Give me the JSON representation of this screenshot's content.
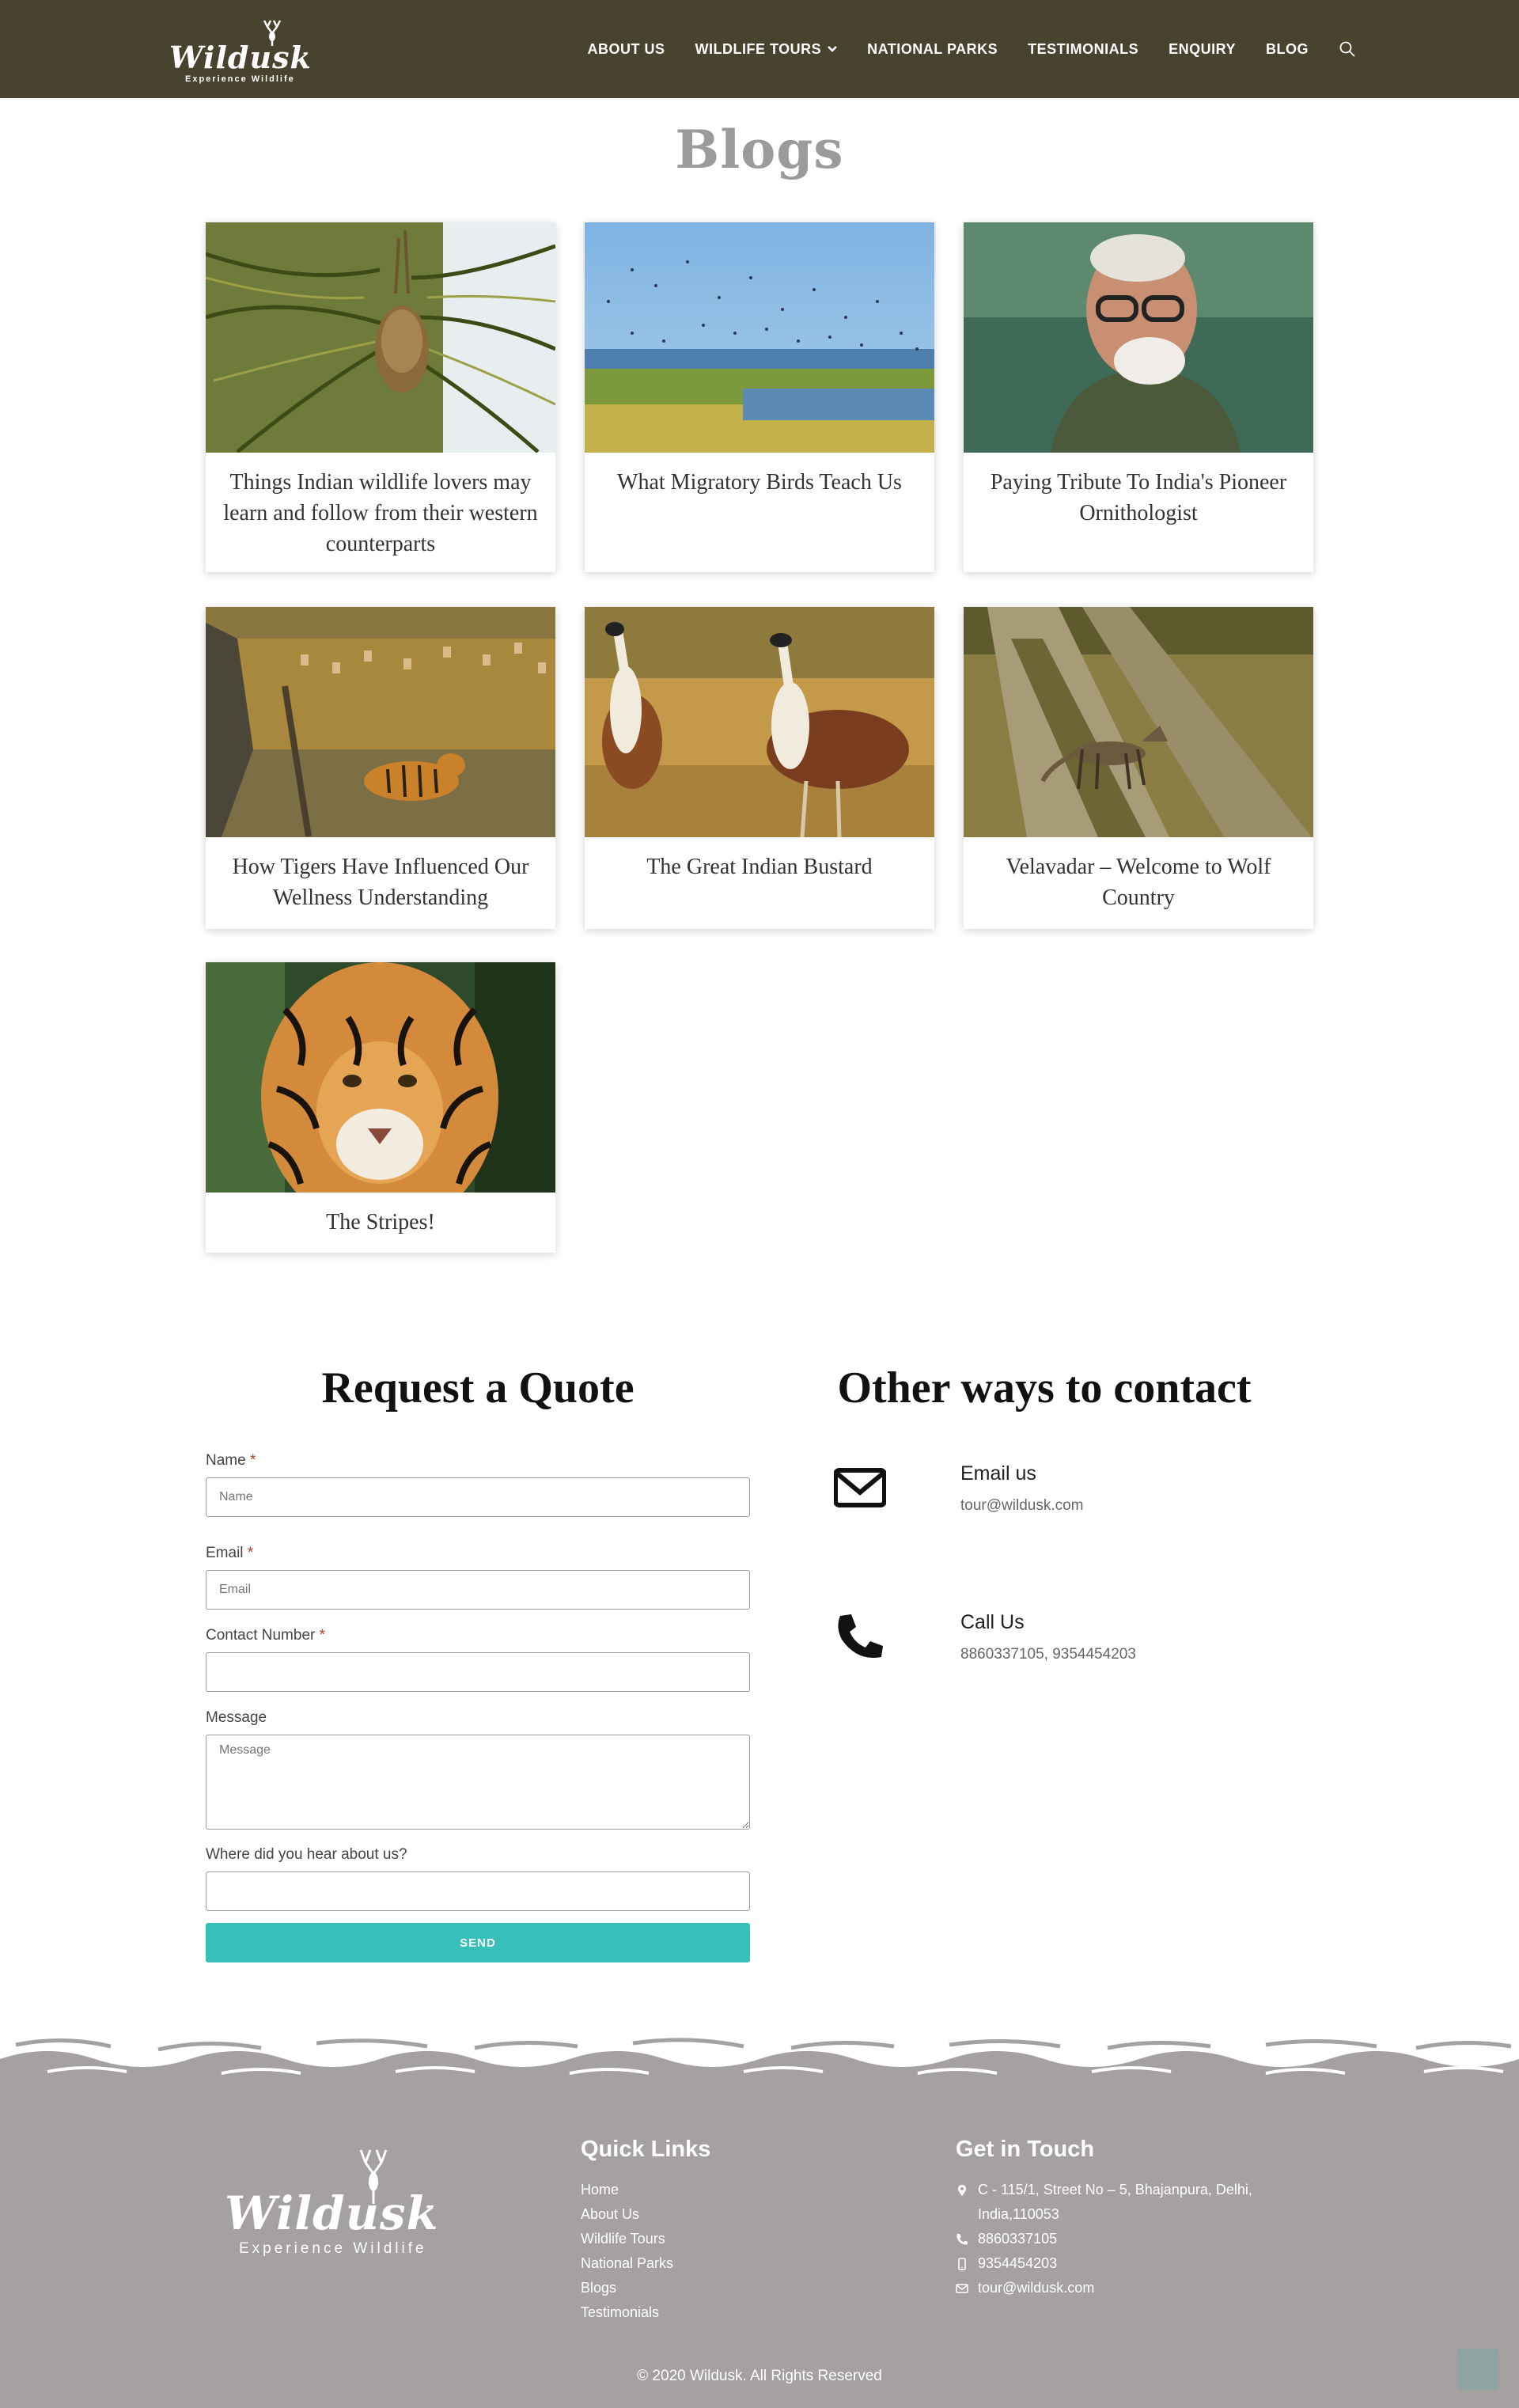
{
  "header": {
    "logo_text": "Wildusk",
    "logo_tagline": "Experience Wildlife",
    "nav": [
      {
        "label": "ABOUT US"
      },
      {
        "label": "WILDLIFE TOURS",
        "has_dropdown": true
      },
      {
        "label": "NATIONAL PARKS"
      },
      {
        "label": "TESTIMONIALS"
      },
      {
        "label": "ENQUIRY"
      },
      {
        "label": "BLOG"
      }
    ],
    "search_icon": "search-icon",
    "bg_color": "#48432f"
  },
  "blogs": {
    "title": "Blogs",
    "cards": [
      {
        "title": "Things Indian wildlife lovers may learn and follow from their western counterparts",
        "image": "weaver-nest-photo"
      },
      {
        "title": "What Migratory Birds Teach Us",
        "image": "migratory-birds-wetland-photo"
      },
      {
        "title": "Paying Tribute To India's Pioneer Ornithologist",
        "image": "ornithologist-portrait-photo"
      },
      {
        "title": "How Tigers Have Influenced Our Wellness Understanding",
        "image": "tiger-grassland-photo"
      },
      {
        "title": "The Great Indian Bustard",
        "image": "bustard-pair-photo"
      },
      {
        "title": "Velavadar – Welcome to Wolf Country",
        "image": "wolf-on-trail-photo"
      },
      {
        "title": "The Stripes!",
        "image": "tiger-face-photo"
      }
    ]
  },
  "quote": {
    "title": "Request a Quote",
    "fields": {
      "name_label": "Name",
      "name_placeholder": "Name",
      "email_label": "Email",
      "email_placeholder": "Email",
      "contact_label": "Contact Number",
      "message_label": "Message",
      "message_placeholder": "Message",
      "hear_label": "Where did you hear about us?",
      "required_mark": "*"
    },
    "send_label": "SEND",
    "accent": "#37bfb9"
  },
  "contact": {
    "title": "Other ways to contact",
    "email_label": "Email us",
    "email_value": "tour@wildusk.com",
    "email_icon": "envelope-icon",
    "call_label": "Call Us",
    "call_value": "8860337105, 9354454203",
    "call_icon": "phone-icon"
  },
  "footer": {
    "logo_text": "Wildusk",
    "logo_tagline": "Experience Wildlife",
    "quick_links_title": "Quick Links",
    "quick_links": [
      "Home",
      "About Us",
      "Wildlife Tours",
      "National Parks",
      "Blogs",
      "Testimonials"
    ],
    "touch_title": "Get in Touch",
    "address_line1": "C - 115/1, Street No – 5, Bhajanpura, Delhi,",
    "address_line2": "India,110053",
    "phone": "8860337105",
    "mobile": "9354454203",
    "email": "tour@wildusk.com",
    "copyright": "© 2020 Wildusk. All Rights Reserved",
    "bg_color": "#a5a1a1"
  }
}
